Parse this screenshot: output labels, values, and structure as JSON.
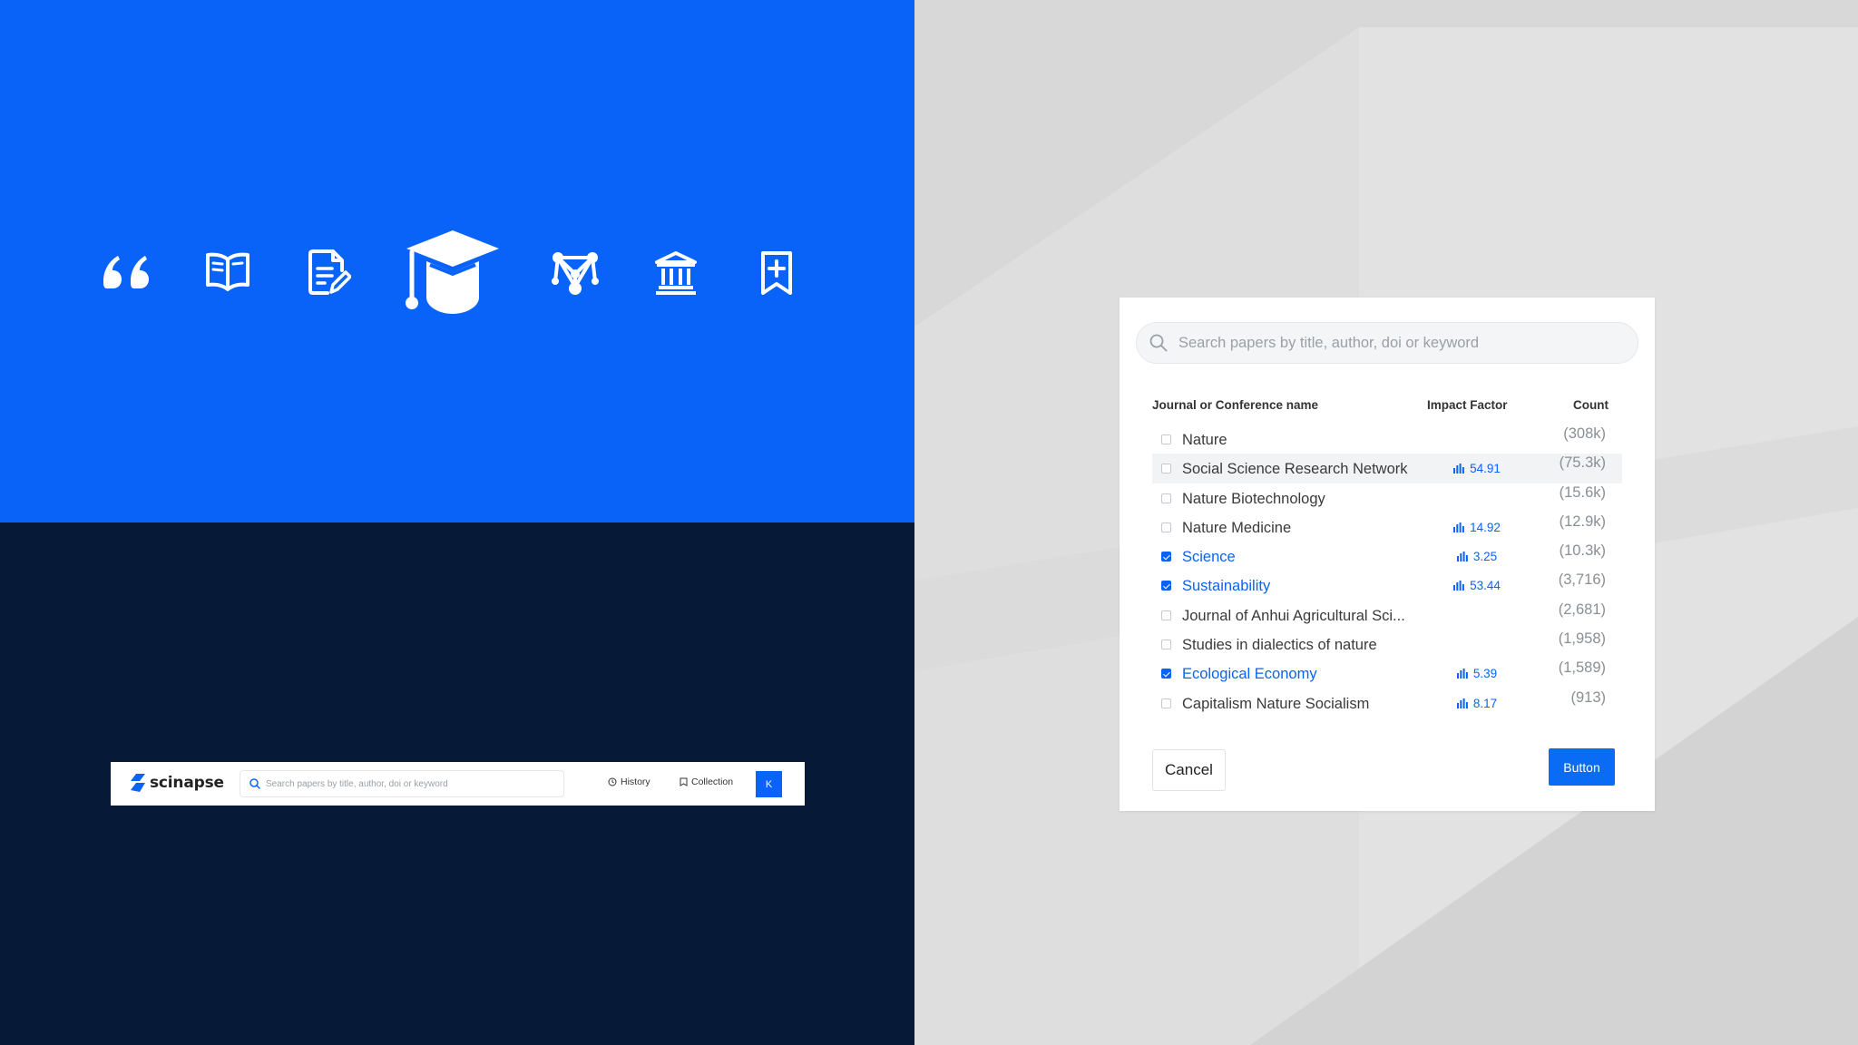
{
  "colors": {
    "brand_blue": "#0a63f9",
    "navy": "#061a37",
    "background_grey": "#d8d8d8"
  },
  "icons": [
    {
      "name": "quote-icon"
    },
    {
      "name": "open-book-icon"
    },
    {
      "name": "document-edit-icon"
    },
    {
      "name": "graduation-cap-icon"
    },
    {
      "name": "network-graph-icon"
    },
    {
      "name": "institution-icon"
    },
    {
      "name": "bookmark-add-icon"
    }
  ],
  "scinapse_bar": {
    "logo_text": "scinapse",
    "search_placeholder": "Search papers by title, author, doi or keyword",
    "history_label": "History",
    "collection_label": "Collection",
    "avatar_initial": "K"
  },
  "dialog": {
    "search_placeholder": "Search papers by title, author, doi or keyword",
    "columns": {
      "name": "Journal or Conference name",
      "impact_factor": "Impact Factor",
      "count": "Count"
    },
    "rows": [
      {
        "name": "Nature",
        "impact_factor": "",
        "count": "(308k)",
        "checked": false
      },
      {
        "name": "Social Science Research Network",
        "impact_factor": "54.91",
        "count": "(75.3k)",
        "checked": false,
        "highlighted": true
      },
      {
        "name": "Nature Biotechnology",
        "impact_factor": "",
        "count": "(15.6k)",
        "checked": false
      },
      {
        "name": "Nature Medicine",
        "impact_factor": "14.92",
        "count": "(12.9k)",
        "checked": false
      },
      {
        "name": "Science",
        "impact_factor": "3.25",
        "count": "(10.3k)",
        "checked": true
      },
      {
        "name": "Sustainability",
        "impact_factor": "53.44",
        "count": "(3,716)",
        "checked": true
      },
      {
        "name": "Journal of Anhui Agricultural Sci...",
        "impact_factor": "",
        "count": "(2,681)",
        "checked": false
      },
      {
        "name": "Studies in dialectics of nature",
        "impact_factor": "",
        "count": "(1,958)",
        "checked": false
      },
      {
        "name": "Ecological Economy",
        "impact_factor": "5.39",
        "count": "(1,589)",
        "checked": true
      },
      {
        "name": "Capitalism Nature Socialism",
        "impact_factor": "8.17",
        "count": "(913)",
        "checked": false
      }
    ],
    "cancel_label": "Cancel",
    "primary_label": "Button"
  }
}
